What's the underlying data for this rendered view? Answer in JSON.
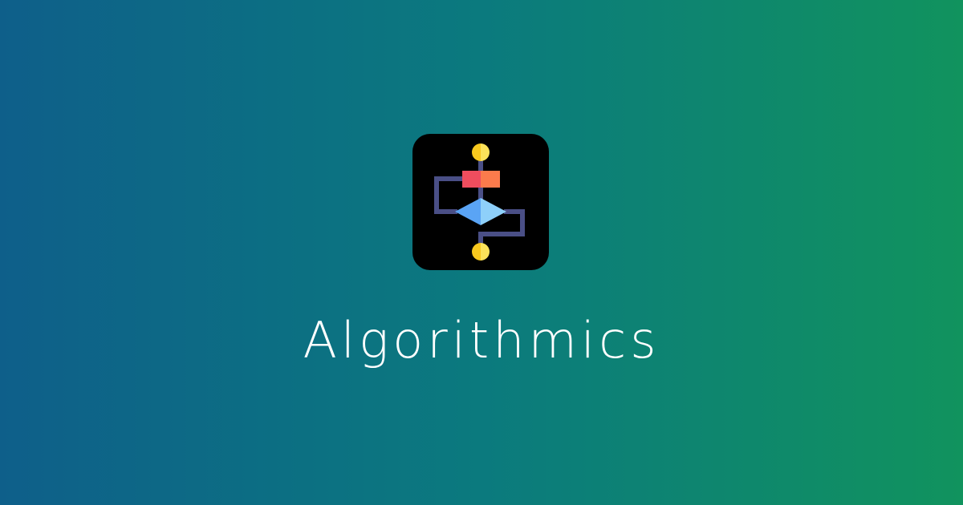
{
  "brand": {
    "name": "Algorithmics",
    "logo_icon": "flowchart-icon",
    "colors": {
      "gradient_start": "#0e5f8a",
      "gradient_mid": "#0b7a7e",
      "gradient_end": "#11935e",
      "icon_background": "#000000",
      "connector": "#4a4f86",
      "terminal": "#f7c81e",
      "process_left": "#ef4d5e",
      "process_right": "#fb7b4c",
      "decision_left": "#5aa4f5",
      "decision_right": "#8ed0fa",
      "text": "#ffffff"
    }
  }
}
